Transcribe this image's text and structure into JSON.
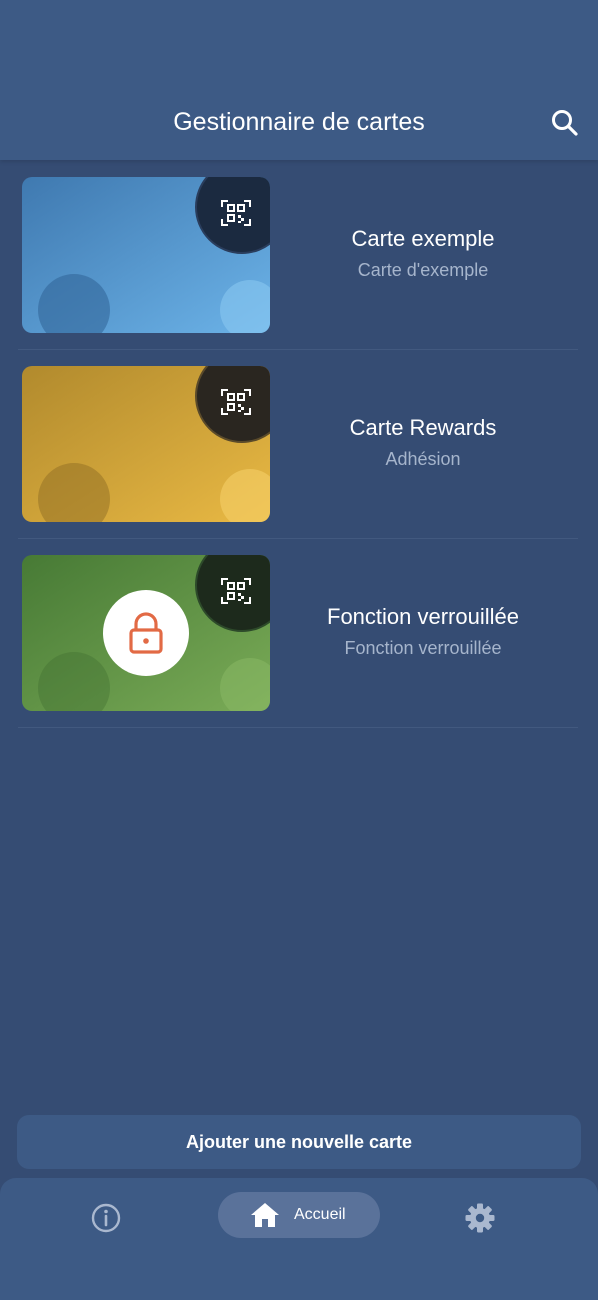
{
  "header": {
    "title": "Gestionnaire de cartes",
    "search_icon": "search-icon"
  },
  "cards": [
    {
      "title": "Carte exemple",
      "subtitle": "Carte d'exemple",
      "color": "#4f8fc8",
      "locked": false
    },
    {
      "title": "Carte Rewards",
      "subtitle": "Adhésion",
      "color": "#d2a33a",
      "locked": false
    },
    {
      "title": "Fonction verrouillée",
      "subtitle": "Fonction verrouillée",
      "color": "#5f9443",
      "locked": true
    }
  ],
  "add_button": {
    "label": "Ajouter une nouvelle carte"
  },
  "nav": {
    "info_icon": "info-icon",
    "home_label": "Accueil",
    "settings_icon": "gear-icon"
  },
  "colors": {
    "background": "#354c73",
    "header": "#3d5a85",
    "nav_active": "#5a729a",
    "lock_accent": "#e26a45"
  }
}
